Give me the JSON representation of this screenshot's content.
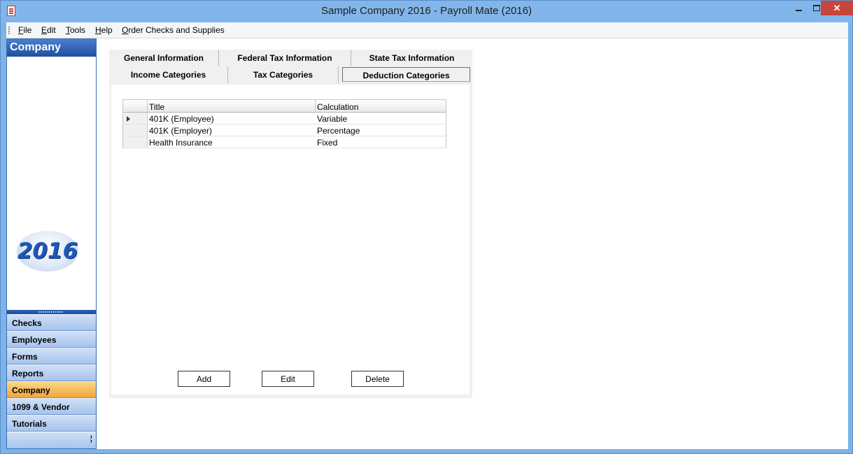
{
  "window": {
    "title": "Sample Company 2016 - Payroll Mate (2016)",
    "close_label": "✕"
  },
  "menu": {
    "items": [
      {
        "accel": "F",
        "rest": "ile"
      },
      {
        "accel": "E",
        "rest": "dit"
      },
      {
        "accel": "T",
        "rest": "ools"
      },
      {
        "accel": "H",
        "rest": "elp"
      },
      {
        "accel": "O",
        "rest": "rder Checks and Supplies"
      }
    ]
  },
  "sidebar": {
    "header": "Company",
    "logo_text": "2016",
    "items": [
      {
        "label": "Checks"
      },
      {
        "label": "Employees"
      },
      {
        "label": "Forms"
      },
      {
        "label": "Reports"
      },
      {
        "label": "Company"
      },
      {
        "label": "1099 & Vendor"
      },
      {
        "label": "Tutorials"
      }
    ],
    "active_item": "Company",
    "footer_icon": "double-chevron-down-icon"
  },
  "tabs": {
    "row1": [
      "General Information",
      "Federal Tax Information",
      "State Tax Information"
    ],
    "row2": [
      "Income Categories",
      "Tax Categories",
      "Deduction Categories"
    ],
    "selected": "Deduction Categories"
  },
  "grid": {
    "columns": [
      "Title",
      "Calculation"
    ],
    "rows": [
      {
        "title": "401K (Employee)",
        "calculation": "Variable"
      },
      {
        "title": "401K (Employer)",
        "calculation": "Percentage"
      },
      {
        "title": "Health Insurance",
        "calculation": "Fixed"
      }
    ],
    "current_row_index": 0
  },
  "buttons": {
    "add": "Add",
    "edit": "Edit",
    "delete": "Delete"
  },
  "colors": {
    "title_bar": "#82b6ea",
    "nav_header": "#1e4f9e",
    "nav_active": "#f1a53c",
    "close_button": "#c7463c"
  }
}
